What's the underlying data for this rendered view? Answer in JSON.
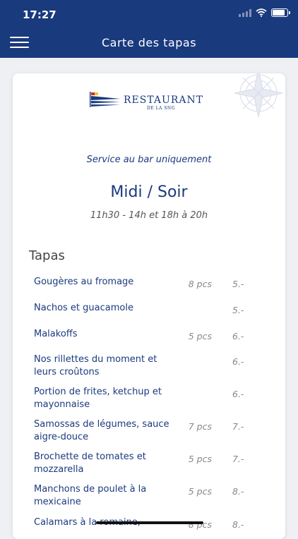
{
  "status_bar": {
    "time": "17:27"
  },
  "header": {
    "title": "Carte des tapas"
  },
  "logo": {
    "name": "RESTAURANT",
    "subtitle": "DE LA SNG"
  },
  "info": {
    "service": "Service au bar uniquement",
    "hours_title": "Midi / Soir",
    "hours_time": "11h30 - 14h et 18h à 20h"
  },
  "section": {
    "title": "Tapas"
  },
  "items": [
    {
      "name": "Gougères au fromage",
      "qty": "8 pcs",
      "price": "5.-"
    },
    {
      "name": "Nachos et guacamole",
      "qty": "",
      "price": "5.-"
    },
    {
      "name": "Malakoffs",
      "qty": "5 pcs",
      "price": "6.-"
    },
    {
      "name": "Nos rillettes du moment et leurs croûtons",
      "qty": "",
      "price": "6.-"
    },
    {
      "name": "Portion de frites, ketchup et mayonnaise",
      "qty": "",
      "price": "6.-"
    },
    {
      "name": "Samossas de légumes, sauce aigre-douce",
      "qty": "7 pcs",
      "price": "7.-"
    },
    {
      "name": "Brochette de tomates et mozzarella",
      "qty": "5 pcs",
      "price": "7.-"
    },
    {
      "name": "Manchons de poulet à la mexicaine",
      "qty": "5 pcs",
      "price": "8.-"
    },
    {
      "name": "Calamars à la romaine,",
      "qty": "8 pcs",
      "price": "8.-"
    }
  ],
  "colors": {
    "brand": "#1a3a7e",
    "background": "#eef0f4"
  },
  "icons": {
    "menu": "hamburger-icon",
    "wifi": "wifi-icon",
    "battery": "battery-icon",
    "signal": "signal-icon",
    "compass": "compass-rose-icon",
    "flag": "flag-logo-icon"
  }
}
